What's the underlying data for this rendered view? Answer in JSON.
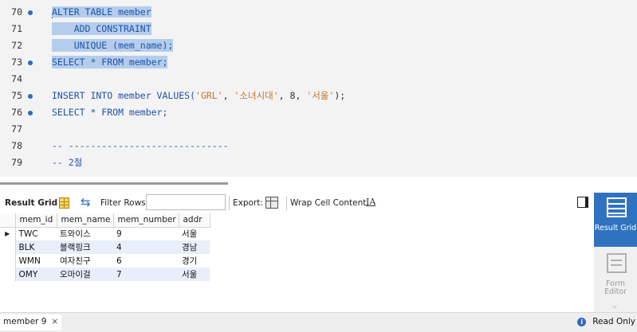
{
  "editor": {
    "lines": [
      {
        "num": "70",
        "dot": true
      },
      {
        "num": "71",
        "dot": false
      },
      {
        "num": "72",
        "dot": false
      },
      {
        "num": "73",
        "dot": true
      },
      {
        "num": "74",
        "dot": false
      },
      {
        "num": "75",
        "dot": true
      },
      {
        "num": "76",
        "dot": true
      },
      {
        "num": "77",
        "dot": false
      },
      {
        "num": "78",
        "dot": false
      },
      {
        "num": "79",
        "dot": false
      }
    ],
    "code": {
      "l70": "ALTER TABLE member",
      "l71": "    ADD CONSTRAINT",
      "l72": "    UNIQUE (mem_name);",
      "l73": "SELECT * FROM member;",
      "l75_pre": "INSERT INTO member VALUES(",
      "l75_s1": "'GRL'",
      "l75_c1": ", ",
      "l75_s2": "'소녀시대'",
      "l75_c2": ", 8, ",
      "l75_s3": "'서울'",
      "l75_post": ");",
      "l76": "SELECT * FROM member;",
      "l78": "-- -----------------------------",
      "l79": "-- 2절"
    }
  },
  "toolbar": {
    "result_grid_label": "Result Grid",
    "filter_rows_label": "Filter Rows:",
    "filter_rows_value": "",
    "export_label": "Export:",
    "wrap_label": "Wrap Cell Content:",
    "wrap_icon_text": "IA"
  },
  "grid": {
    "columns": [
      "mem_id",
      "mem_name",
      "mem_number",
      "addr"
    ],
    "rows": [
      [
        "TWC",
        "트와이스",
        "9",
        "서울"
      ],
      [
        "BLK",
        "블랙핑크",
        "4",
        "경남"
      ],
      [
        "WMN",
        "여자친구",
        "6",
        "경기"
      ],
      [
        "OMY",
        "오마이걸",
        "7",
        "서울"
      ]
    ],
    "current_row_marker": "▶"
  },
  "right_panel": {
    "result_grid": "Result Grid",
    "form_editor": "Form Editor"
  },
  "bottom": {
    "tab_label": "member 9",
    "tab_close": "×",
    "status": "Read Only",
    "status_icon": "i"
  },
  "colors": {
    "accent": "#2f73c0",
    "selection": "#b4cdec",
    "keyword": "#1d52a8",
    "string": "#c0782f",
    "row_stripe": "#e8eefa"
  }
}
